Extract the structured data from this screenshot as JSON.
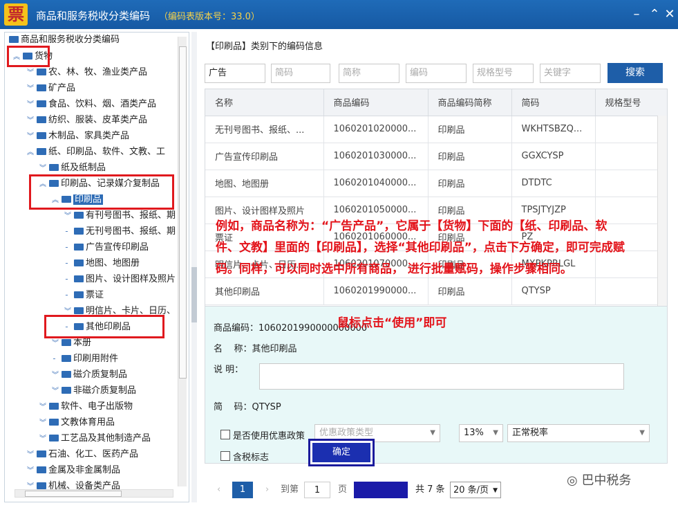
{
  "window": {
    "logo": "票",
    "title": "商品和服务税收分类编码",
    "version": "（编码表版本号：33.0）",
    "minimize": "–",
    "expand": "⌃",
    "close": "✕"
  },
  "tree": {
    "root": "商品和服务税收分类编码",
    "goods": "货物",
    "n1": "农、林、牧、渔业类产品",
    "n2": "矿产品",
    "n3": "食品、饮料、烟、酒类产品",
    "n4": "纺织、服装、皮革类产品",
    "n5": "木制品、家具类产品",
    "n6": "纸、印刷品、软件、文教、工",
    "n7": "纸及纸制品",
    "n8": "印刷品、记录媒介复制品",
    "n9": "印刷品",
    "n10": "有刊号图书、报纸、期",
    "n11": "无刊号图书、报纸、期",
    "n12": "广告宣传印刷品",
    "n13": "地图、地图册",
    "n14": "图片、设计图样及照片",
    "n15": "票证",
    "n16": "明信片、卡片、日历、",
    "n17": "其他印刷品",
    "n18": "本册",
    "n19": "印刷用附件",
    "n20": "磁介质复制品",
    "n21": "非磁介质复制品",
    "n22": "软件、电子出版物",
    "n23": "文教体育用品",
    "n24": "工艺品及其他制造产品",
    "n25": "石油、化工、医药产品",
    "n26": "金属及非金属制品",
    "n27": "机械、设备类产品"
  },
  "main": {
    "section_title": "【印刷品】类别下的编码信息",
    "filters": {
      "name": "广告",
      "short_code": "简码",
      "short_name": "简称",
      "code": "编码",
      "spec": "规格型号",
      "keyword": "关键字"
    },
    "search_button": "搜索",
    "columns": [
      "名称",
      "商品编码",
      "商品编码简称",
      "简码",
      "规格型号"
    ],
    "rows": [
      [
        "无刊号图书、报纸、...",
        "1060201020000...",
        "印刷品",
        "WKHTSBZQ...",
        ""
      ],
      [
        "广告宣传印刷品",
        "1060201030000...",
        "印刷品",
        "GGXCYSP",
        ""
      ],
      [
        "地图、地图册",
        "1060201040000...",
        "印刷品",
        "DTDTC",
        ""
      ],
      [
        "图片、设计图样及照片",
        "1060201050000...",
        "印刷品",
        "TPSJTYJZP",
        ""
      ],
      [
        "票证",
        "1060201060000...",
        "印刷品",
        "PZ",
        ""
      ],
      [
        "明信片、卡片、日历...",
        "1060201070000...",
        "印刷品",
        "MXPKPRLGL",
        ""
      ],
      [
        "其他印刷品",
        "1060201990000...",
        "印刷品",
        "QTYSP",
        ""
      ]
    ],
    "detail": {
      "code_label": "商品编码：",
      "code_value": "1060201990000000000",
      "name_label": "名    称：",
      "name_value": "其他印刷品",
      "desc_label": "说    明：",
      "short_label": "简    码：",
      "short_value": "QTYSP",
      "preferential_label": "是否使用优惠政策",
      "policy_placeholder": "优惠政策类型",
      "rate": "13%",
      "rate_type": "正常税率",
      "tax_incl_label": "含税标志",
      "ok_button": "确定"
    },
    "pager": {
      "prev": "‹",
      "page": "1",
      "next": "›",
      "goto": "到第",
      "page_input": "1",
      "page_unit": "页",
      "total": "共 7 条",
      "per_page": "20 条/页"
    }
  },
  "annotations": {
    "para": "例如，商品名称为：“广告产品”，它属于【货物】下面的【纸、印刷品、软件、文教】里面的【印刷品】，选择“其他印刷品”，点击下方确定，即可完成赋码。同样，可以同时选中所有商品， 进行批量赋码，操作步骤相同。",
    "hint": "鼠标点击“使用”即可",
    "watermark": "巴中税务"
  },
  "colors": {
    "titlebar": "#1659a3",
    "accent": "#1e5ea8",
    "annotation": "#e3131a",
    "detail_bg": "#e8f8f8"
  }
}
